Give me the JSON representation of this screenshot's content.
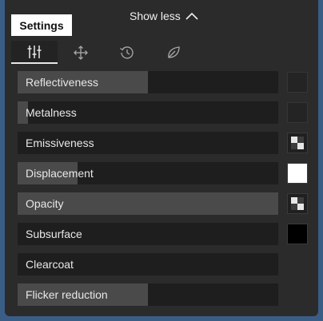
{
  "header": {
    "show_less_label": "Show less",
    "show_less_icon": "chevron-up-icon"
  },
  "tabs": {
    "settings_label": "Settings",
    "icon_tabs": [
      {
        "icon": "sliders-icon",
        "active": true
      },
      {
        "icon": "move-arrows-icon",
        "active": false
      },
      {
        "icon": "history-icon",
        "active": false
      },
      {
        "icon": "leaf-icon",
        "active": false
      }
    ]
  },
  "sliders": [
    {
      "label": "Reflectiveness",
      "value": 0.5,
      "swatch": "dark"
    },
    {
      "label": "Metalness",
      "value": 0.04,
      "swatch": "dark"
    },
    {
      "label": "Emissiveness",
      "value": 0.0,
      "swatch": "checker"
    },
    {
      "label": "Displacement",
      "value": 0.23,
      "swatch": "white"
    },
    {
      "label": "Opacity",
      "value": 1.0,
      "swatch": "checker"
    },
    {
      "label": "Subsurface",
      "value": 0.0,
      "swatch": "black"
    },
    {
      "label": "Clearcoat",
      "value": 0.0,
      "swatch": "none"
    },
    {
      "label": "Flicker reduction",
      "value": 0.5,
      "swatch": "none"
    }
  ],
  "colors": {
    "panel_bg": "#2b2b2b",
    "slider_track": "#1e1e1e",
    "slider_fill": "#4a4a4a",
    "page_bg": "#3a5d86"
  }
}
